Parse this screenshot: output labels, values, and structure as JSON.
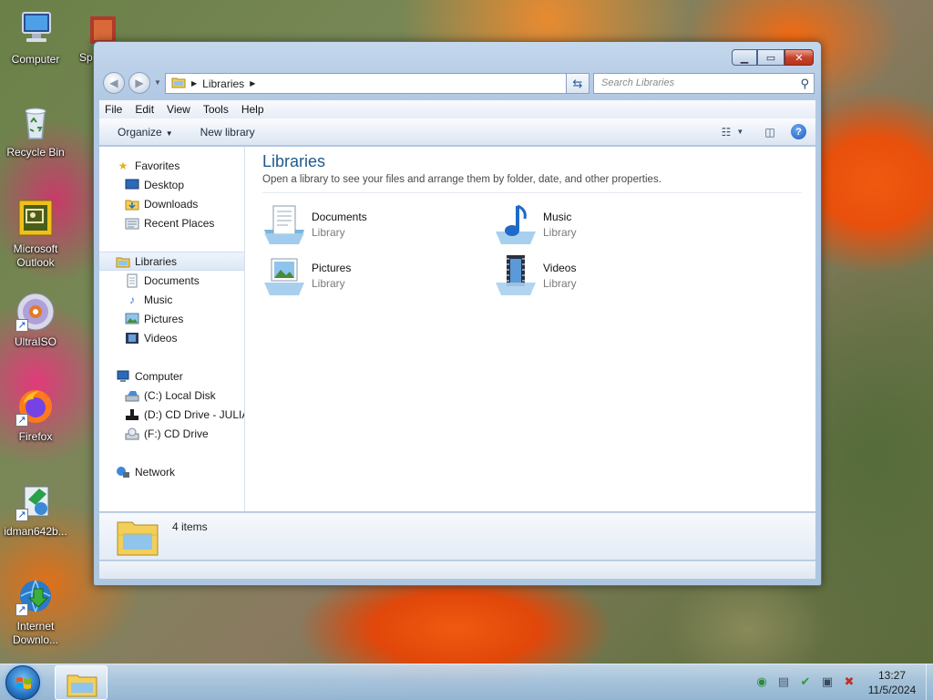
{
  "desktop": {
    "icons": [
      {
        "label": "Computer"
      },
      {
        "label": "Recycle Bin"
      },
      {
        "label": "Microsoft Outlook"
      },
      {
        "label": "UltraISO"
      },
      {
        "label": "Firefox"
      },
      {
        "label": "idman642b..."
      },
      {
        "label": "Internet Downlo..."
      },
      {
        "label": "Sp"
      }
    ]
  },
  "window": {
    "address": {
      "crumb": "Libraries"
    },
    "search": {
      "placeholder": "Search Libraries"
    },
    "menu": [
      {
        "label": "File"
      },
      {
        "label": "Edit"
      },
      {
        "label": "View"
      },
      {
        "label": "Tools"
      },
      {
        "label": "Help"
      }
    ],
    "toolbar": {
      "organize": "Organize",
      "new_library": "New library"
    },
    "nav": {
      "favorites": "Favorites",
      "desktop": "Desktop",
      "downloads": "Downloads",
      "recent": "Recent Places",
      "libraries": "Libraries",
      "documents": "Documents",
      "music": "Music",
      "pictures": "Pictures",
      "videos": "Videos",
      "computer": "Computer",
      "c_drive": "(C:) Local Disk",
      "d_drive": "(D:) CD Drive - JULIA",
      "f_drive": "(F:) CD Drive",
      "network": "Network"
    },
    "main": {
      "title": "Libraries",
      "description": "Open a library to see your files and arrange them by folder, date, and other properties.",
      "libraries": [
        {
          "name": "Documents",
          "type": "Library"
        },
        {
          "name": "Music",
          "type": "Library"
        },
        {
          "name": "Pictures",
          "type": "Library"
        },
        {
          "name": "Videos",
          "type": "Library"
        }
      ]
    },
    "details": {
      "count": "4 items"
    }
  },
  "taskbar": {
    "time": "13:27",
    "date": "11/5/2024"
  }
}
